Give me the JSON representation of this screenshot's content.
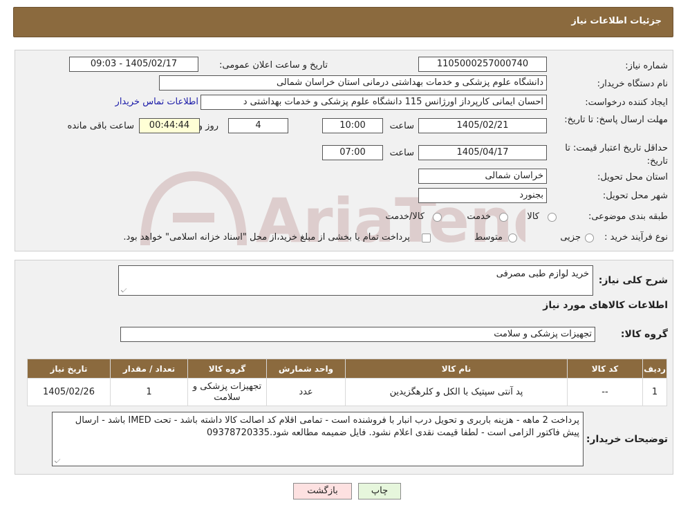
{
  "header": {
    "title": "جزئیات اطلاعات نیاز"
  },
  "form": {
    "need_number_label": "شماره نیاز:",
    "need_number": "1105000257000740",
    "announce_label": "تاریخ و ساعت اعلان عمومی:",
    "announce_value": "1405/02/17 - 09:03",
    "buyer_org_label": "نام دستگاه خریدار:",
    "buyer_org": "دانشگاه علوم پزشکی و خدمات بهداشتی درمانی استان خراسان شمالی",
    "creator_label": "ایجاد کننده درخواست:",
    "creator": "احسان ایمانی کارپرداز اورژانس 115 دانشگاه علوم پزشکی و خدمات بهداشتی د",
    "contact_link": "اطلاعات تماس خریدار",
    "deadline_label": "مهلت ارسال پاسخ: تا تاریخ:",
    "deadline_date": "1405/02/21",
    "time_label": "ساعت",
    "deadline_time": "10:00",
    "days_value": "4",
    "days_label": "روز و",
    "remaining_time": "00:44:44",
    "remaining_label": "ساعت باقی مانده",
    "validity_label": "حداقل تاریخ اعتبار قیمت: تا تاریخ:",
    "validity_date": "1405/04/17",
    "validity_time": "07:00",
    "province_label": "استان محل تحویل:",
    "province": "خراسان شمالی",
    "city_label": "شهر محل تحویل:",
    "city": "بجنورد",
    "category_label": "طبقه بندی موضوعی:",
    "category_options": [
      "کالا",
      "خدمت",
      "کالا/خدمت"
    ],
    "process_label": "نوع فرآیند خرید :",
    "process_options": [
      "جزیی",
      "متوسط"
    ],
    "payment_note": "پرداخت تمام یا بخشی از مبلغ خرید،از محل \"اسناد خزانه اسلامی\" خواهد بود."
  },
  "details": {
    "general_desc_label": "شرح کلی نیاز:",
    "general_desc": "خرید لوازم طبی مصرفی",
    "goods_info_title": "اطلاعات کالاهای مورد نیاز",
    "goods_group_label": "گروه کالا:",
    "goods_group": "تجهیزات پزشکی و سلامت",
    "table": {
      "headers": [
        "ردیف",
        "کد کالا",
        "نام کالا",
        "واحد شمارش",
        "گروه کالا",
        "تعداد / مقدار",
        "تاریخ نیاز"
      ],
      "rows": [
        [
          "1",
          "--",
          "پد آنتی سپتیک با الکل و کلرهگزیدین",
          "عدد",
          "تجهیزات پزشکی و سلامت",
          "1",
          "1405/02/26"
        ]
      ]
    },
    "buyer_notes_label": "توضیحات خریدار:",
    "buyer_notes": "پرداخت 2 ماهه - هزینه باربری و تحویل درب انبار با فروشنده است - تمامی اقلام کد اصالت کالا داشته باشد - تحت IMED باشد - ارسال پیش فاکتور الزامی است - لطفا قیمت نقدی اعلام نشود. فایل ضمیمه مطالعه شود.09378720335"
  },
  "buttons": {
    "print": "چاپ",
    "back": "بازگشت"
  },
  "colors": {
    "header_bg": "#8b6a3e",
    "panel_bg": "#f1f1f1",
    "back_btn_bg": "#fde1e1",
    "print_btn_bg": "#e6f6dc"
  }
}
